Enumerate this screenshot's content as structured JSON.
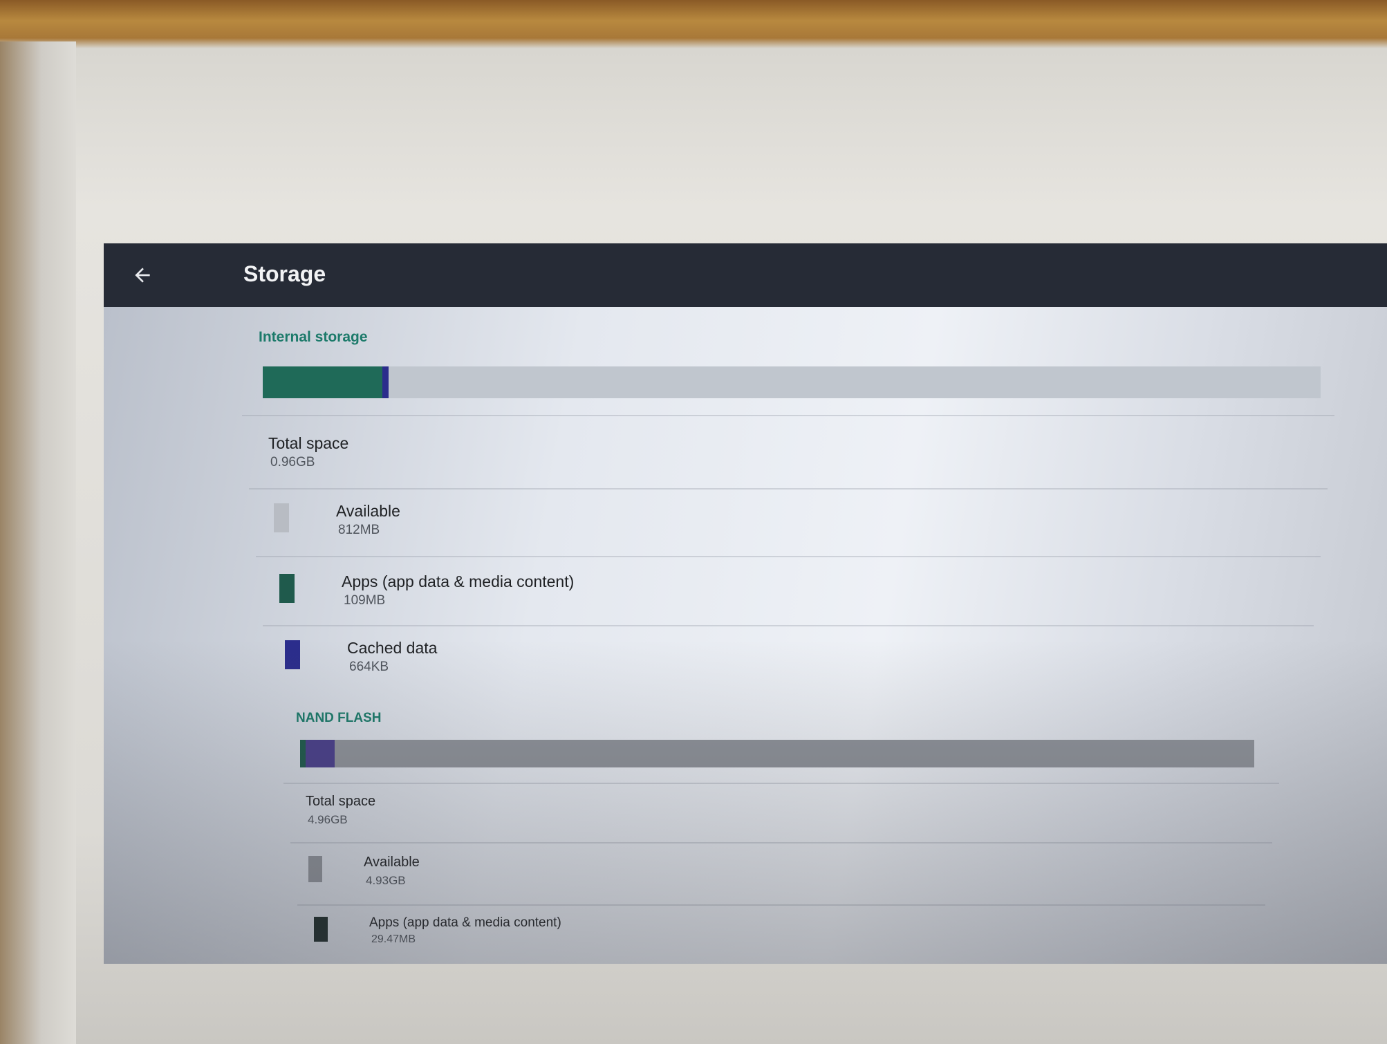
{
  "appbar": {
    "title": "Storage",
    "back_icon": "arrow-back-icon"
  },
  "internal": {
    "section_title": "Internal storage",
    "usage": {
      "apps_fraction": 0.113,
      "cached_fraction": 0.006,
      "apps_color": "#1f6a58",
      "cached_color": "#2b2d8c",
      "available_color": "#c0c6ce"
    },
    "total": {
      "label": "Total space",
      "value": "0.96GB"
    },
    "items": [
      {
        "label": "Available",
        "value": "812MB",
        "color": "#b8bcc3"
      },
      {
        "label": "Apps (app data & media content)",
        "value": "109MB",
        "color": "#1f5a4c"
      },
      {
        "label": "Cached data",
        "value": "664KB",
        "color": "#2b2d8c"
      }
    ]
  },
  "nand": {
    "section_title": "NAND FLASH",
    "usage": {
      "apps_fraction": 0.006,
      "cached_fraction": 0.03,
      "apps_color": "#1f5a4c",
      "cached_color": "#4a3f8a",
      "available_color": "#8e9299"
    },
    "total": {
      "label": "Total space",
      "value": "4.96GB"
    },
    "items": [
      {
        "label": "Available",
        "value": "4.93GB",
        "color": "#8e9299"
      },
      {
        "label": "Apps (app data & media content)",
        "value": "29.47MB",
        "color": "#1b2a28"
      }
    ]
  }
}
